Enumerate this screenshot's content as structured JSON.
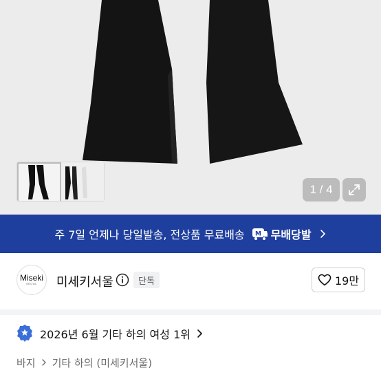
{
  "gallery": {
    "counter": "1 / 4",
    "current_index": 1,
    "total": 4
  },
  "delivery_banner": {
    "text": "주 7일 언제나 당일발송, 전상품 무료배송",
    "brand_label": "무배당발"
  },
  "seller": {
    "logo_text": "Miseki",
    "logo_subtext": "SEOUL",
    "name": "미세키서울",
    "exclusive_badge": "단독",
    "like_count": "19만"
  },
  "ranking": {
    "text": "2026년 6월 기타 하의 여성 1위"
  },
  "breadcrumb": {
    "items": [
      "바지",
      "기타 하의 (미세키서울)"
    ]
  },
  "colors": {
    "banner": "#1f3f9e",
    "rank_badge": "#3a6fd8"
  }
}
